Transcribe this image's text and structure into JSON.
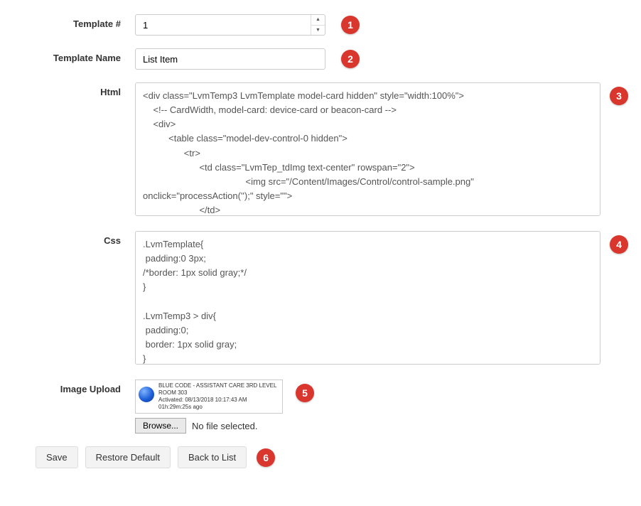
{
  "labels": {
    "template_number": "Template #",
    "template_name": "Template Name",
    "html": "Html",
    "css": "Css",
    "image_upload": "Image Upload"
  },
  "fields": {
    "template_number": "1",
    "template_name": "List Item",
    "html_code": "<div class=\"LvmTemp3 LvmTemplate model-card hidden\" style=\"width:100%\">\n    <!-- CardWidth, model-card: device-card or beacon-card -->\n    <div>\n          <table class=\"model-dev-control-0 hidden\">\n                <tr>\n                      <td class=\"LvmTep_tdImg text-center\" rowspan=\"2\">\n                                        <img src=\"/Content/Images/Control/control-sample.png\"\nonclick=\"processAction('');\" style=\"\">\n                      </td>",
    "css_code": ".LvmTemplate{\n padding:0 3px;\n/*border: 1px solid gray;*/\n}\n\n.LvmTemp3 > div{\n padding:0;\n border: 1px solid gray;\n}"
  },
  "preview": {
    "line1": "BLUE CODE - ASSISTANT CARE 3RD LEVEL",
    "line2": "ROOM 303",
    "line3": "Activated: 08/13/2018 10:17:43 AM",
    "line4": "01h:29m:25s ago"
  },
  "file": {
    "browse": "Browse...",
    "status": "No file selected."
  },
  "buttons": {
    "save": "Save",
    "restore": "Restore Default",
    "back": "Back to List"
  },
  "badges": {
    "b1": "1",
    "b2": "2",
    "b3": "3",
    "b4": "4",
    "b5": "5",
    "b6": "6"
  }
}
